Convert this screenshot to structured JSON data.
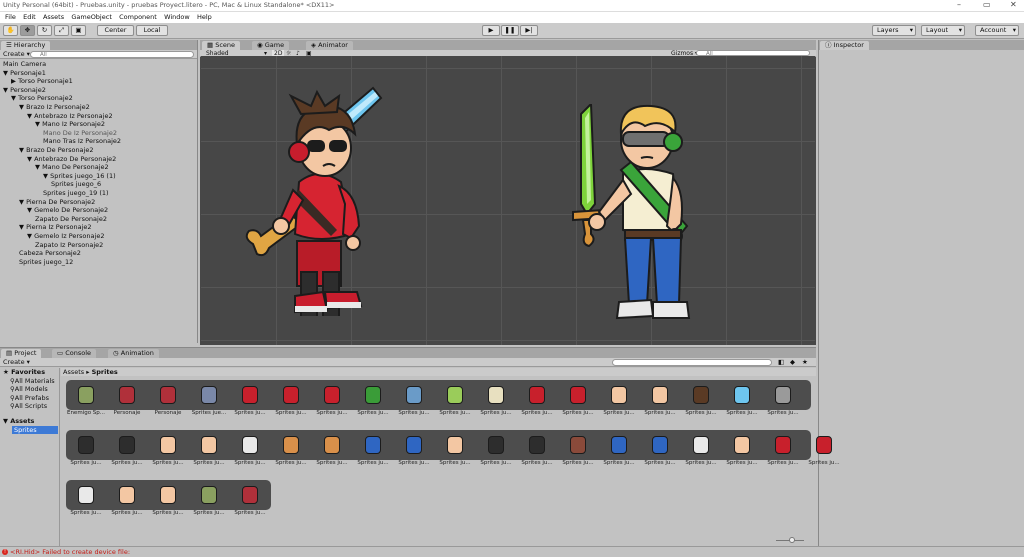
{
  "window": {
    "title": "Unity Personal (64bit) - Pruebas.unity - pruebas Proyect.litero - PC, Mac & Linux Standalone* <DX11>",
    "min": "–",
    "max": "▭",
    "close": "✕"
  },
  "menu": [
    "File",
    "Edit",
    "Assets",
    "GameObject",
    "Component",
    "Window",
    "Help"
  ],
  "toolbar": {
    "center": "Center",
    "local": "Local",
    "layers": "Layers",
    "layout": "Layout",
    "account": "Account"
  },
  "hierarchy": {
    "tab": "Hierarchy",
    "create": "Create",
    "search_placeholder": "All",
    "rows": [
      {
        "label": "Main Camera",
        "depth": 0,
        "arrow": ""
      },
      {
        "label": "Personaje1",
        "depth": 0,
        "arrow": "▼"
      },
      {
        "label": "Torso Personaje1",
        "depth": 1,
        "arrow": "▶"
      },
      {
        "label": "Personaje2",
        "depth": 0,
        "arrow": "▼"
      },
      {
        "label": "Torso Personaje2",
        "depth": 1,
        "arrow": "▼"
      },
      {
        "label": "Brazo Iz Personaje2",
        "depth": 2,
        "arrow": "▼"
      },
      {
        "label": "Antebrazo Iz Personaje2",
        "depth": 3,
        "arrow": "▼"
      },
      {
        "label": "Mano Iz Personaje2",
        "depth": 4,
        "arrow": "▼"
      },
      {
        "label": "Mano De Iz Personaje2",
        "depth": 5,
        "arrow": "",
        "dim": true
      },
      {
        "label": "Mano Tras Iz Personaje2",
        "depth": 5,
        "arrow": ""
      },
      {
        "label": "Brazo De Personaje2",
        "depth": 2,
        "arrow": "▼"
      },
      {
        "label": "Antebrazo De Personaje2",
        "depth": 3,
        "arrow": "▼"
      },
      {
        "label": "Mano De Personaje2",
        "depth": 4,
        "arrow": "▼"
      },
      {
        "label": "Sprites juego_16 (1)",
        "depth": 5,
        "arrow": "▼"
      },
      {
        "label": "Sprites juego_6",
        "depth": 6,
        "arrow": ""
      },
      {
        "label": "Sprites juego_19 (1)",
        "depth": 5,
        "arrow": ""
      },
      {
        "label": "Pierna De Personaje2",
        "depth": 2,
        "arrow": "▼"
      },
      {
        "label": "Gemelo De Personaje2",
        "depth": 3,
        "arrow": "▼"
      },
      {
        "label": "Zapato De Personaje2",
        "depth": 4,
        "arrow": ""
      },
      {
        "label": "Pierna Iz Personaje2",
        "depth": 2,
        "arrow": "▼"
      },
      {
        "label": "Gemelo Iz Personaje2",
        "depth": 3,
        "arrow": "▼"
      },
      {
        "label": "Zapato Iz Personaje2",
        "depth": 4,
        "arrow": ""
      },
      {
        "label": "Cabeza Personaje2",
        "depth": 2,
        "arrow": ""
      },
      {
        "label": "Sprites juego_12",
        "depth": 2,
        "arrow": ""
      }
    ]
  },
  "scene": {
    "tabs": [
      "Scene",
      "Game",
      "Animator"
    ],
    "shaded": "Shaded",
    "mode2d": "2D",
    "gizmos": "Gizmos",
    "search_placeholder": "All"
  },
  "inspector": {
    "tab": "Inspector"
  },
  "project": {
    "tabs": [
      "Project",
      "Console",
      "Animation"
    ],
    "create": "Create",
    "breadcrumb_root": "Assets",
    "breadcrumb_leaf": "Sprites",
    "favorites_header": "Favorites",
    "favorites": [
      "All Materials",
      "All Models",
      "All Prefabs",
      "All Scripts"
    ],
    "assets_header": "Assets",
    "assets_children": [
      "Sprites"
    ],
    "row1": [
      "Enemigo Sp...",
      "Personaje",
      "Personaje",
      "Sprites jue...",
      "Sprites ju...",
      "Sprites ju...",
      "Sprites ju...",
      "Sprites ju...",
      "Sprites ju...",
      "Sprites ju...",
      "Sprites ju...",
      "Sprites ju...",
      "Sprites ju...",
      "Sprites ju...",
      "Sprites ju...",
      "Sprites ju...",
      "Sprites ju...",
      "Sprites ju..."
    ],
    "row2": [
      "Sprites ju...",
      "Sprites ju...",
      "Sprites ju...",
      "Sprites ju...",
      "Sprites ju...",
      "Sprites ju...",
      "Sprites ju...",
      "Sprites ju...",
      "Sprites ju...",
      "Sprites ju...",
      "Sprites ju...",
      "Sprites ju...",
      "Sprites ju...",
      "Sprites ju...",
      "Sprites ju...",
      "Sprites ju...",
      "Sprites ju...",
      "Sprites ju...",
      "Sprites ju..."
    ],
    "row3": [
      "Sprites ju...",
      "Sprites ju...",
      "Sprites ju...",
      "Sprites ju...",
      "Sprites ju..."
    ]
  },
  "status": {
    "message": "<RI.Hid> Failed to create device file:"
  },
  "colors": {
    "error": "#d9251d",
    "scene_bg": "#474747",
    "sword_blue": "#6ec6ef",
    "sword_green": "#7ed33b"
  }
}
